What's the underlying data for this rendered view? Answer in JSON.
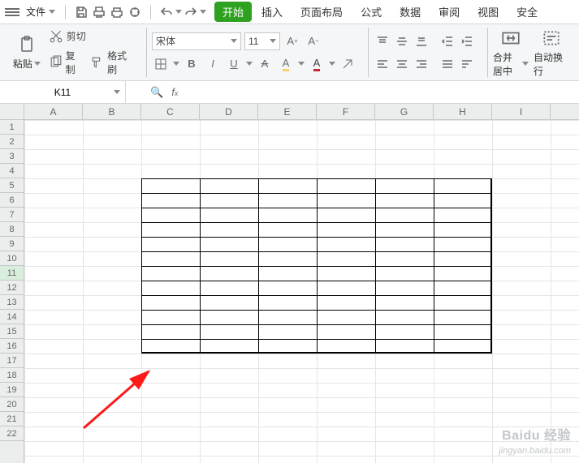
{
  "menubar": {
    "file_label": "文件",
    "tabs": [
      "开始",
      "插入",
      "页面布局",
      "公式",
      "数据",
      "审阅",
      "视图",
      "安全"
    ],
    "active_tab_index": 0
  },
  "ribbon": {
    "paste_label": "粘贴",
    "cut_label": "剪切",
    "copy_label": "复制",
    "format_painter_label": "格式刷",
    "font_name": "宋体",
    "font_size": "11",
    "merge_center_label": "合并居中",
    "wrap_text_label": "自动换行"
  },
  "cellref": {
    "name": "K11",
    "formula": ""
  },
  "grid": {
    "columns": [
      "A",
      "B",
      "C",
      "D",
      "E",
      "F",
      "G",
      "H",
      "I"
    ],
    "rows": [
      1,
      2,
      3,
      4,
      5,
      6,
      7,
      8,
      9,
      10,
      11,
      12,
      13,
      14,
      15,
      16,
      17,
      18,
      19,
      20,
      21,
      22
    ],
    "active_row": 11,
    "bordered_range": "C5:H16"
  },
  "watermark": {
    "brand": "Baidu 经验",
    "sub": "jingyan.baidu.com"
  }
}
